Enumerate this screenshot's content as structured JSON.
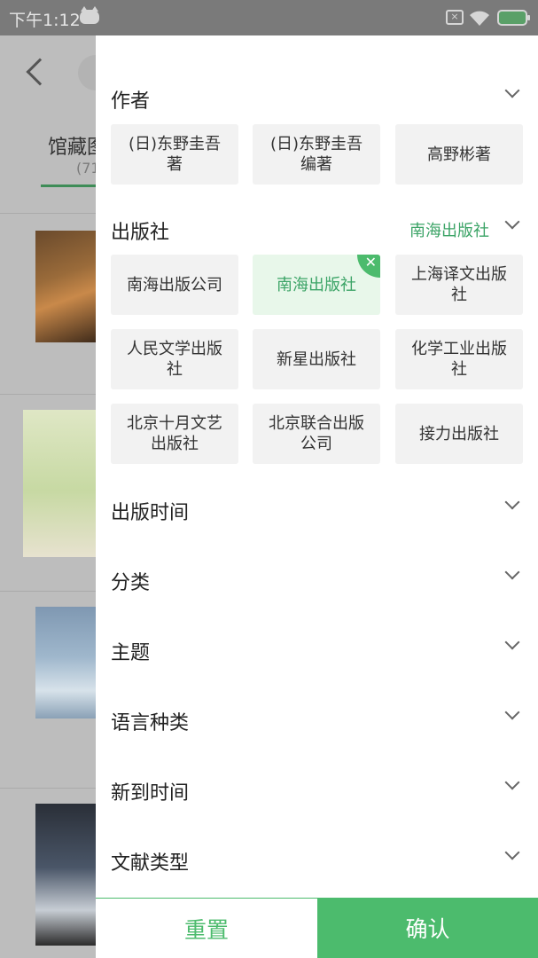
{
  "status_bar": {
    "time": "下午1:12"
  },
  "background_page": {
    "tab_label": "馆藏图",
    "tab_count": "(71"
  },
  "filters": {
    "author": {
      "title": "作者",
      "options": [
        "(日)东野圭吾著",
        "(日)东野圭吾编著",
        "高野彬著"
      ]
    },
    "publisher": {
      "title": "出版社",
      "selected_value": "南海出版社",
      "options": [
        "南海出版公司",
        "南海出版社",
        "上海译文出版社",
        "人民文学出版社",
        "新星出版社",
        "化学工业出版社",
        "北京十月文艺出版社",
        "北京联合出版公司",
        "接力出版社"
      ]
    },
    "pub_time": {
      "title": "出版时间"
    },
    "category": {
      "title": "分类"
    },
    "subject": {
      "title": "主题"
    },
    "language": {
      "title": "语言种类"
    },
    "new_arrival": {
      "title": "新到时间"
    },
    "doc_type": {
      "title": "文献类型"
    }
  },
  "buttons": {
    "reset": "重置",
    "confirm": "确认"
  },
  "colors": {
    "accent": "#4cbb6d",
    "accent_text": "#3ca467",
    "chip_bg": "#f2f2f2",
    "chip_selected_bg": "#e8f7ea"
  }
}
